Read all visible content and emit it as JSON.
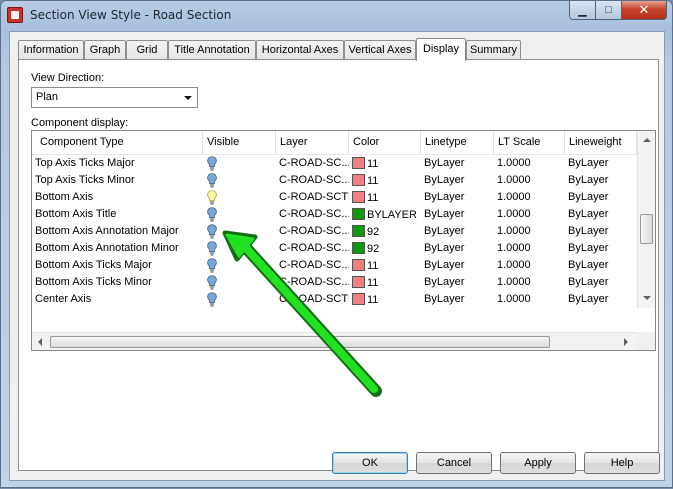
{
  "window": {
    "title": "Section View Style - Road Section",
    "minimize_label": "▁",
    "maximize_label": "□",
    "close_label": "✕"
  },
  "tabs": [
    {
      "label": "Information"
    },
    {
      "label": "Graph"
    },
    {
      "label": "Grid"
    },
    {
      "label": "Title Annotation"
    },
    {
      "label": "Horizontal Axes"
    },
    {
      "label": "Vertical Axes"
    },
    {
      "label": "Display",
      "active": true
    },
    {
      "label": "Summary"
    }
  ],
  "display": {
    "view_direction_label": "View Direction:",
    "view_direction_value": "Plan",
    "component_display_label": "Component display:",
    "columns": [
      "Component Type",
      "Visible",
      "Layer",
      "Color",
      "Linetype",
      "LT Scale",
      "Lineweight"
    ],
    "rows": [
      {
        "type": "Top Axis Ticks Major",
        "visible": true,
        "layer": "C-ROAD-SC...",
        "color": "11",
        "color_hex": "#f08080",
        "linetype": "ByLayer",
        "lt_scale": "1.0000",
        "lineweight": "ByLayer"
      },
      {
        "type": "Top Axis Ticks Minor",
        "visible": true,
        "layer": "C-ROAD-SC...",
        "color": "11",
        "color_hex": "#f08080",
        "linetype": "ByLayer",
        "lt_scale": "1.0000",
        "lineweight": "ByLayer"
      },
      {
        "type": "Bottom Axis",
        "visible": false,
        "layer": "C-ROAD-SCTN",
        "color": "11",
        "color_hex": "#f08080",
        "linetype": "ByLayer",
        "lt_scale": "1.0000",
        "lineweight": "ByLayer"
      },
      {
        "type": "Bottom Axis Title",
        "visible": true,
        "layer": "C-ROAD-SC...",
        "color": "BYLAYER",
        "color_hex": "#0a9a0a",
        "linetype": "ByLayer",
        "lt_scale": "1.0000",
        "lineweight": "ByLayer"
      },
      {
        "type": "Bottom Axis Annotation Major",
        "visible": true,
        "layer": "C-ROAD-SC...",
        "color": "92",
        "color_hex": "#0a9a0a",
        "linetype": "ByLayer",
        "lt_scale": "1.0000",
        "lineweight": "ByLayer"
      },
      {
        "type": "Bottom Axis Annotation Minor",
        "visible": true,
        "layer": "C-ROAD-SC...",
        "color": "92",
        "color_hex": "#0a9a0a",
        "linetype": "ByLayer",
        "lt_scale": "1.0000",
        "lineweight": "ByLayer"
      },
      {
        "type": "Bottom Axis Ticks Major",
        "visible": true,
        "layer": "C-ROAD-SC...",
        "color": "11",
        "color_hex": "#f08080",
        "linetype": "ByLayer",
        "lt_scale": "1.0000",
        "lineweight": "ByLayer"
      },
      {
        "type": "Bottom Axis Ticks Minor",
        "visible": true,
        "layer": "C-ROAD-SC...",
        "color": "11",
        "color_hex": "#f08080",
        "linetype": "ByLayer",
        "lt_scale": "1.0000",
        "lineweight": "ByLayer"
      },
      {
        "type": "Center Axis",
        "visible": true,
        "layer": "C-ROAD-SCTN",
        "color": "11",
        "color_hex": "#f08080",
        "linetype": "ByLayer",
        "lt_scale": "1.0000",
        "lineweight": "ByLayer"
      }
    ]
  },
  "buttons": {
    "ok": "OK",
    "cancel": "Cancel",
    "apply": "Apply",
    "help": "Help"
  },
  "colors": {
    "annotation_arrow": "#22e022",
    "bulb_on": "#7aa7d6",
    "bulb_off": "#f3ee8a"
  }
}
